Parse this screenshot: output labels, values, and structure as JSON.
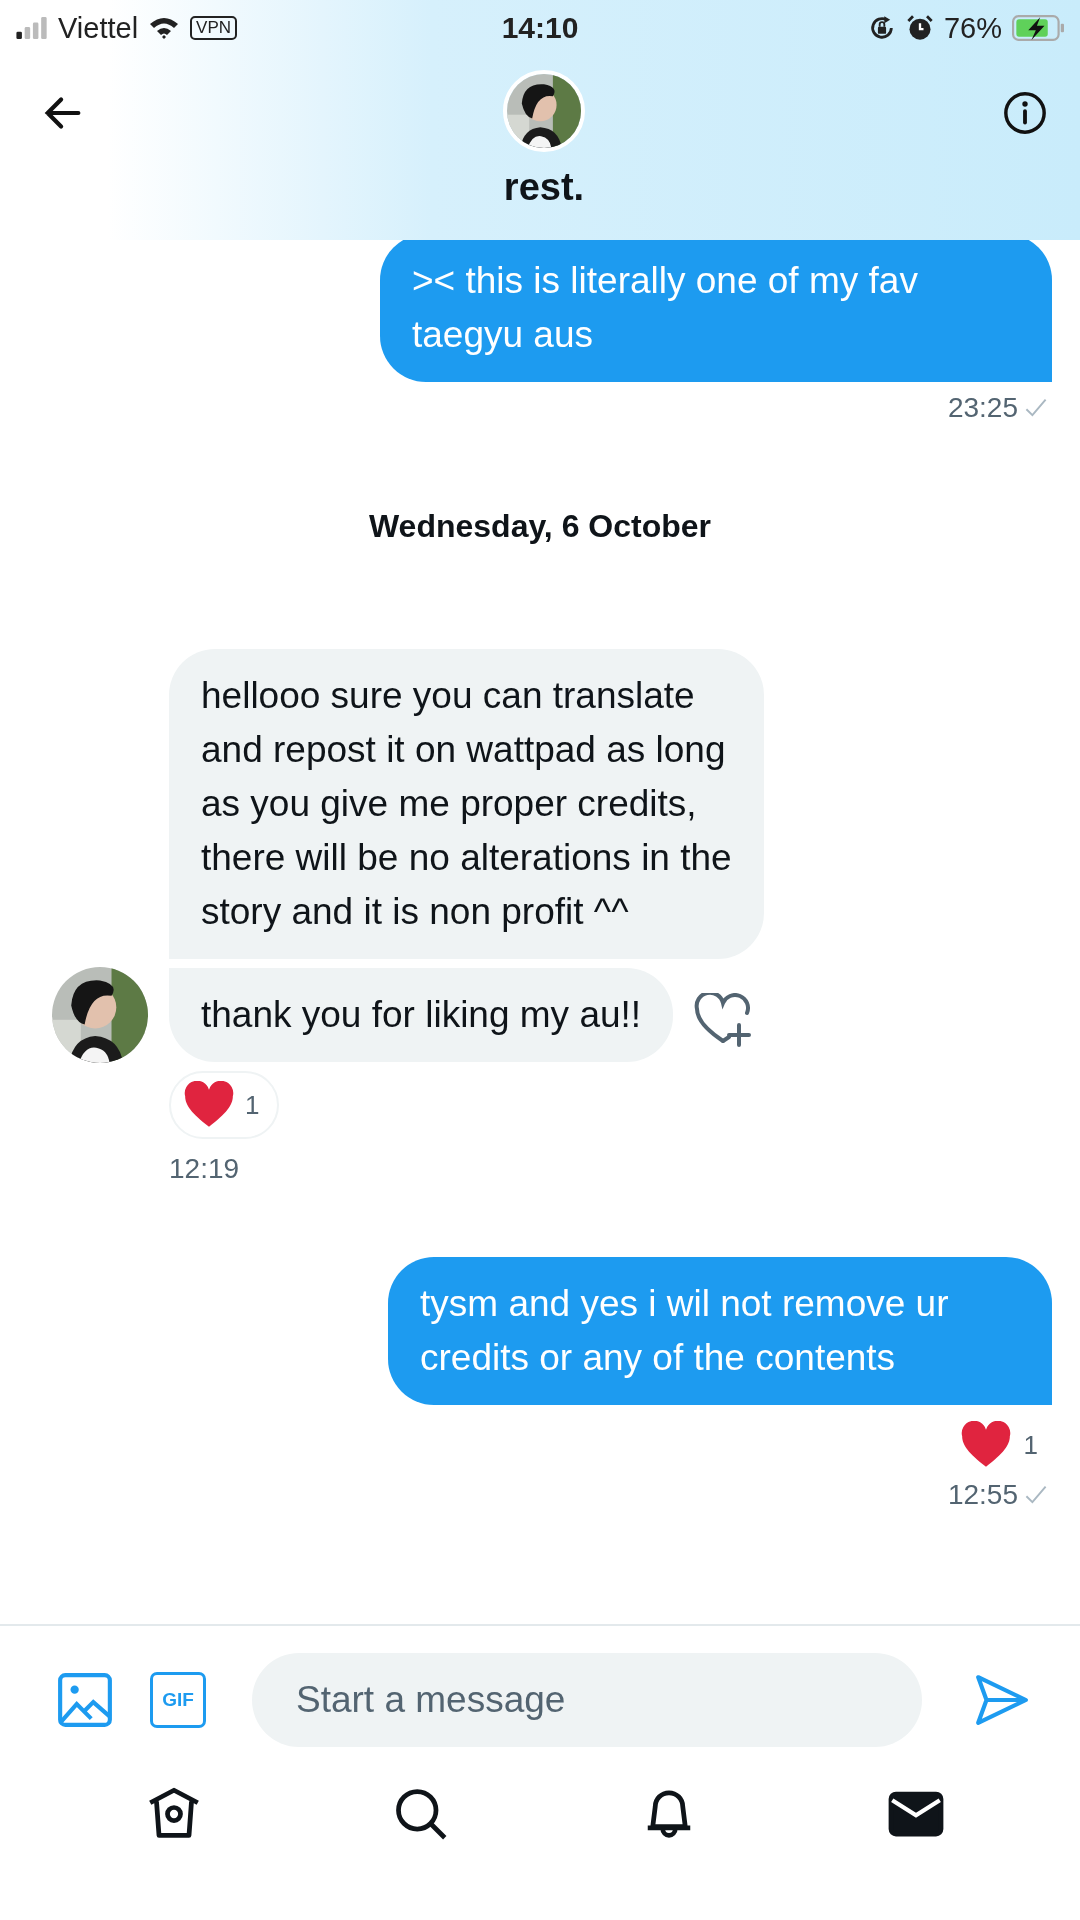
{
  "status_bar": {
    "carrier": "Viettel",
    "vpn": "VPN",
    "time": "14:10",
    "battery": "76%"
  },
  "header": {
    "name": "rest."
  },
  "timeline": [
    {
      "kind": "sent",
      "lines": [
        ">< this is literally one of my fav",
        "taegyu aus"
      ],
      "time": "23:25",
      "read": true
    },
    {
      "kind": "date",
      "text": "Wednesday, 6 October"
    },
    {
      "kind": "received",
      "bubbles": [
        {
          "lines": [
            "hellooo sure you can translate",
            "and repost it on wattpad as long",
            "as you give me proper credits,",
            "there will be no alterations in the",
            "story and it is non profit ^^"
          ]
        },
        {
          "lines": [
            "thank you for liking my au!!"
          ]
        }
      ],
      "reaction": {
        "count": "1"
      },
      "time": "12:19"
    },
    {
      "kind": "sent",
      "lines": [
        "tysm and yes i wil not remove ur",
        "credits or any of the contents"
      ],
      "reaction": {
        "count": "1"
      },
      "time": "12:55",
      "read": true
    }
  ],
  "composer": {
    "placeholder": "Start a message",
    "gif_label": "GIF"
  },
  "nav": [
    {
      "kind": "home",
      "selected": false
    },
    {
      "kind": "search",
      "selected": false
    },
    {
      "kind": "bell",
      "selected": false
    },
    {
      "kind": "mail",
      "selected": true
    }
  ]
}
